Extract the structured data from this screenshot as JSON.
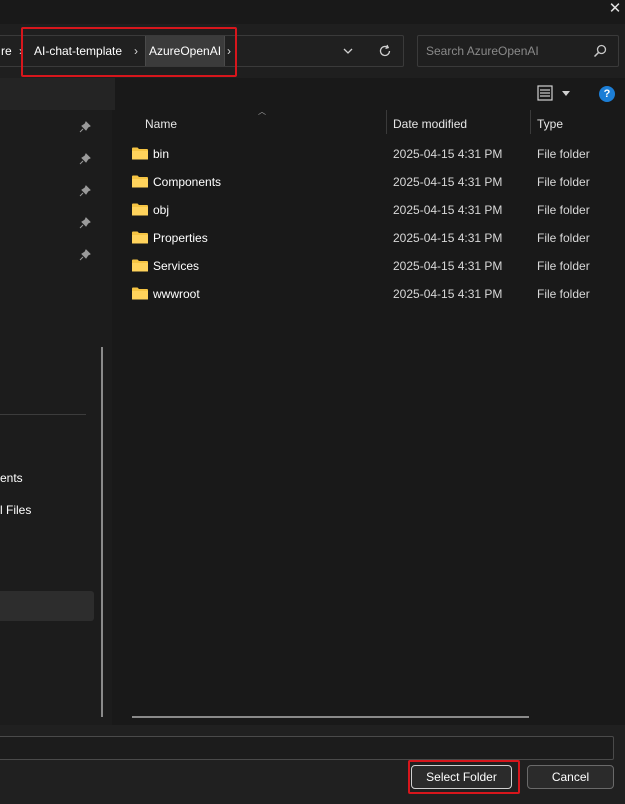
{
  "window": {
    "close_label": "✕"
  },
  "breadcrumb": {
    "items": [
      {
        "label": "re"
      },
      {
        "label": "AI-chat-template"
      },
      {
        "label": "AzureOpenAI"
      }
    ],
    "separator": "›"
  },
  "search": {
    "placeholder": "Search AzureOpenAI"
  },
  "help": {
    "label": "?"
  },
  "nav": {
    "partial_items": [
      "ents",
      "l Files"
    ]
  },
  "columns": {
    "name": "Name",
    "date": "Date modified",
    "type": "Type"
  },
  "files": [
    {
      "name": "bin",
      "date": "2025-04-15 4:31 PM",
      "type": "File folder"
    },
    {
      "name": "Components",
      "date": "2025-04-15 4:31 PM",
      "type": "File folder"
    },
    {
      "name": "obj",
      "date": "2025-04-15 4:31 PM",
      "type": "File folder"
    },
    {
      "name": "Properties",
      "date": "2025-04-15 4:31 PM",
      "type": "File folder"
    },
    {
      "name": "Services",
      "date": "2025-04-15 4:31 PM",
      "type": "File folder"
    },
    {
      "name": "wwwroot",
      "date": "2025-04-15 4:31 PM",
      "type": "File folder"
    }
  ],
  "footer": {
    "folder_value": "",
    "select_label": "Select Folder",
    "cancel_label": "Cancel"
  },
  "colors": {
    "background": "#191919",
    "highlight": "#d7161c",
    "folder": "#f5c443",
    "help": "#1c7ed6"
  }
}
